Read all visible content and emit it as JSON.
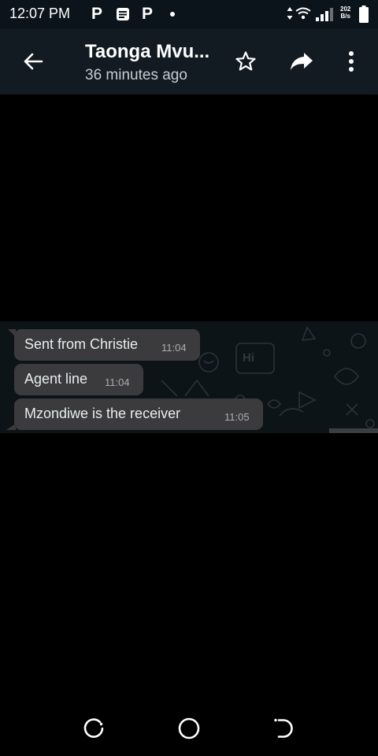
{
  "status_bar": {
    "time": "12:07 PM",
    "notification_icons": [
      "P",
      "message-icon",
      "P"
    ],
    "network_speed_value": "202",
    "network_speed_unit": "B/s"
  },
  "header": {
    "contact_name": "Taonga Mvu...",
    "last_seen": "36 minutes ago",
    "icons": [
      "back-arrow-icon",
      "star-icon",
      "forward-icon",
      "more-vert-icon"
    ]
  },
  "messages": [
    {
      "text": "Sent from Christie",
      "time": "11:04"
    },
    {
      "text": "Agent line",
      "time": "11:04"
    },
    {
      "text": "Mzondiwe is the receiver",
      "time": "11:05"
    }
  ],
  "doodle_text": "Hi",
  "nav_bar": [
    "recent-apps-icon",
    "home-icon",
    "back-icon"
  ],
  "colors": {
    "background": "#000000",
    "header": "#111b21",
    "bubble": "#3b3b3d",
    "timestamp": "#a9adb0"
  }
}
